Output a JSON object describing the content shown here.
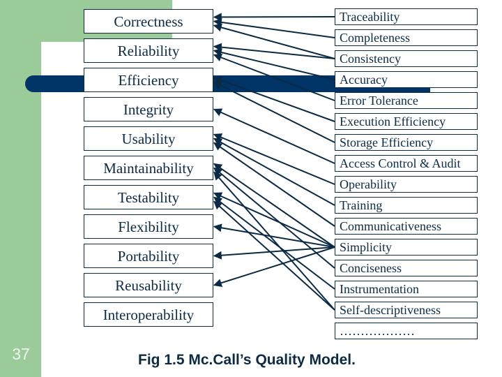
{
  "slide": {
    "page_number": "37",
    "caption": "Fig 1.5 Mc.Call’s Quality Model.",
    "colors": {
      "accent_green": "#9ccb9a",
      "navy": "#003366",
      "box_text": "#0b2a45"
    }
  },
  "factors": [
    "Correctness",
    "Reliability",
    "Efficiency",
    "Integrity",
    "Usability",
    "Maintainability",
    "Testability",
    "Flexibility",
    "Portability",
    "Reusability",
    "Interoperability"
  ],
  "criteria": [
    "Traceability",
    "Completeness",
    "Consistency",
    "Accuracy",
    "Error Tolerance",
    "Execution Efficiency",
    "Storage Efficiency",
    "Access Control & Audit",
    "Operability",
    "Training",
    "Communicativeness",
    "Simplicity",
    "Conciseness",
    "Instrumentation",
    "Self-descriptiveness",
    "………………"
  ],
  "links": [
    {
      "from": "Traceability",
      "to": "Correctness"
    },
    {
      "from": "Completeness",
      "to": "Correctness"
    },
    {
      "from": "Consistency",
      "to": "Correctness"
    },
    {
      "from": "Consistency",
      "to": "Reliability"
    },
    {
      "from": "Accuracy",
      "to": "Reliability"
    },
    {
      "from": "Error Tolerance",
      "to": "Reliability"
    },
    {
      "from": "Execution Efficiency",
      "to": "Efficiency"
    },
    {
      "from": "Storage Efficiency",
      "to": "Efficiency"
    },
    {
      "from": "Access Control & Audit",
      "to": "Integrity"
    },
    {
      "from": "Operability",
      "to": "Usability"
    },
    {
      "from": "Training",
      "to": "Usability"
    },
    {
      "from": "Communicativeness",
      "to": "Usability"
    },
    {
      "from": "Simplicity",
      "to": "Maintainability"
    },
    {
      "from": "Conciseness",
      "to": "Maintainability"
    },
    {
      "from": "Self-descriptiveness",
      "to": "Maintainability"
    },
    {
      "from": "Simplicity",
      "to": "Testability"
    },
    {
      "from": "Instrumentation",
      "to": "Testability"
    },
    {
      "from": "Self-descriptiveness",
      "to": "Testability"
    },
    {
      "from": "Simplicity",
      "to": "Flexibility"
    },
    {
      "from": "Simplicity",
      "to": "Portability"
    },
    {
      "from": "Simplicity",
      "to": "Reusability"
    }
  ]
}
